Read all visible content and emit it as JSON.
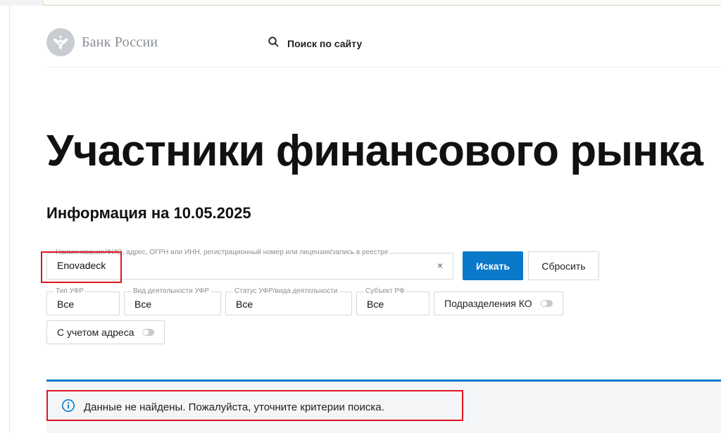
{
  "header": {
    "logo_text": "Банк России",
    "site_search_label": "Поиск по сайту"
  },
  "page": {
    "title": "Участники финансового рынка",
    "info_date": "Информация на 10.05.2025"
  },
  "search": {
    "label": "Наименование/ФИО, адрес, ОГРН или ИНН, регистрационный номер или лицензия/запись в реестре",
    "value": "Enovadeck",
    "clear_symbol": "×",
    "search_button": "Искать",
    "reset_button": "Сбросить"
  },
  "filters": [
    {
      "label": "Тип УФР",
      "value": "Все"
    },
    {
      "label": "Вид деятельности УФР",
      "value": "Все"
    },
    {
      "label": "Статус УФР/вида деятельности",
      "value": "Все"
    },
    {
      "label": "Субъект РФ",
      "value": "Все"
    }
  ],
  "toggles": {
    "subdivisions": "Подразделения КО",
    "with_address": "С учетом адреса"
  },
  "result": {
    "message": "Данные не найдены. Пожалуйста, уточните критерии поиска."
  },
  "colors": {
    "accent": "#0a79c9",
    "highlight": "#e0151d",
    "logo_gray": "#8a8f96"
  },
  "icons": {
    "logo": "eagle-emblem-icon",
    "site_search": "search-icon",
    "notice": "info-icon"
  }
}
